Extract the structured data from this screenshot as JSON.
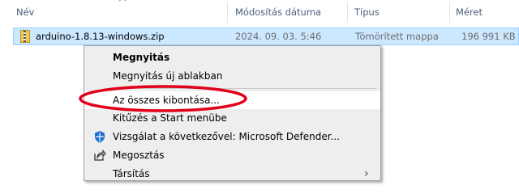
{
  "columns": {
    "name": "Név",
    "modified": "Módosítás dátuma",
    "type": "Típus",
    "size": "Méret"
  },
  "file": {
    "name": "arduino-1.8.13-windows.zip",
    "modified": "2024. 09. 03. 5:46",
    "type": "Tömörített mappa",
    "size": "196 991 KB",
    "icon": "zip-folder-icon"
  },
  "context_menu": {
    "open": "Megnyitás",
    "open_new_window": "Megnyitás új ablakban",
    "extract_all": "Az összes kibontása...",
    "pin_to_start": "Kitűzés a Start menübe",
    "scan_defender": "Vizsgálat a következővel: Microsoft Defender...",
    "share": "Megosztás",
    "open_with": "Társítás"
  },
  "colors": {
    "selection": "#cce8ff",
    "annotation": "#e0001b"
  }
}
